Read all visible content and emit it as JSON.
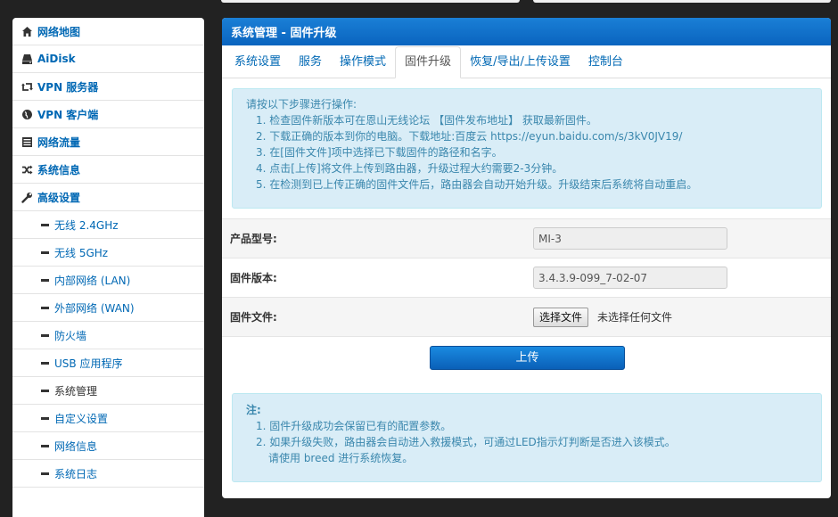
{
  "sidebar": {
    "items": [
      {
        "label": "网络地图",
        "icon": "home-icon"
      },
      {
        "label": "AiDisk",
        "icon": "hdd-icon"
      },
      {
        "label": "VPN 服务器",
        "icon": "retweet-icon"
      },
      {
        "label": "VPN 客户端",
        "icon": "globe-icon"
      },
      {
        "label": "网络流量",
        "icon": "list-icon"
      },
      {
        "label": "系统信息",
        "icon": "shuffle-icon"
      },
      {
        "label": "高级设置",
        "icon": "wrench-icon"
      }
    ],
    "subitems": [
      {
        "label": "无线 2.4GHz"
      },
      {
        "label": "无线 5GHz"
      },
      {
        "label": "内部网络 (LAN)"
      },
      {
        "label": "外部网络 (WAN)"
      },
      {
        "label": "防火墙"
      },
      {
        "label": "USB 应用程序"
      },
      {
        "label": "系统管理"
      },
      {
        "label": "自定义设置"
      },
      {
        "label": "网络信息"
      },
      {
        "label": "系统日志"
      }
    ]
  },
  "panel": {
    "title": "系统管理 - 固件升级",
    "tabs": [
      "系统设置",
      "服务",
      "操作模式",
      "固件升级",
      "恢复/导出/上传设置",
      "控制台"
    ],
    "active_tab": "固件升级"
  },
  "instructions": {
    "intro": "请按以下步骤进行操作:",
    "steps": [
      "1. 检查固件新版本可在恩山无线论坛 【固件发布地址】 获取最新固件。",
      "2. 下载正确的版本到你的电脑。下载地址:百度云 https://eyun.baidu.com/s/3kV0JV19/",
      "3. 在[固件文件]项中选择已下载固件的路径和名字。",
      "4. 点击[上传]将文件上传到路由器，升级过程大约需要2-3分钟。",
      "5. 在检测到已上传正确的固件文件后，路由器会自动开始升级。升级结束后系统将自动重启。"
    ]
  },
  "form": {
    "model_label": "产品型号:",
    "model_value": "MI-3",
    "version_label": "固件版本:",
    "version_value": "3.4.3.9-099_7-02-07",
    "file_label": "固件文件:",
    "file_button": "选择文件",
    "file_none": "未选择任何文件",
    "upload_button": "上传"
  },
  "notes": {
    "title": "注:",
    "lines": [
      "1. 固件升级成功会保留已有的配置参数。",
      "2. 如果升级失败，路由器会自动进入救援模式，可通过LED指示灯判断是否进入该模式。",
      "请使用 breed 进行系统恢复。"
    ]
  }
}
